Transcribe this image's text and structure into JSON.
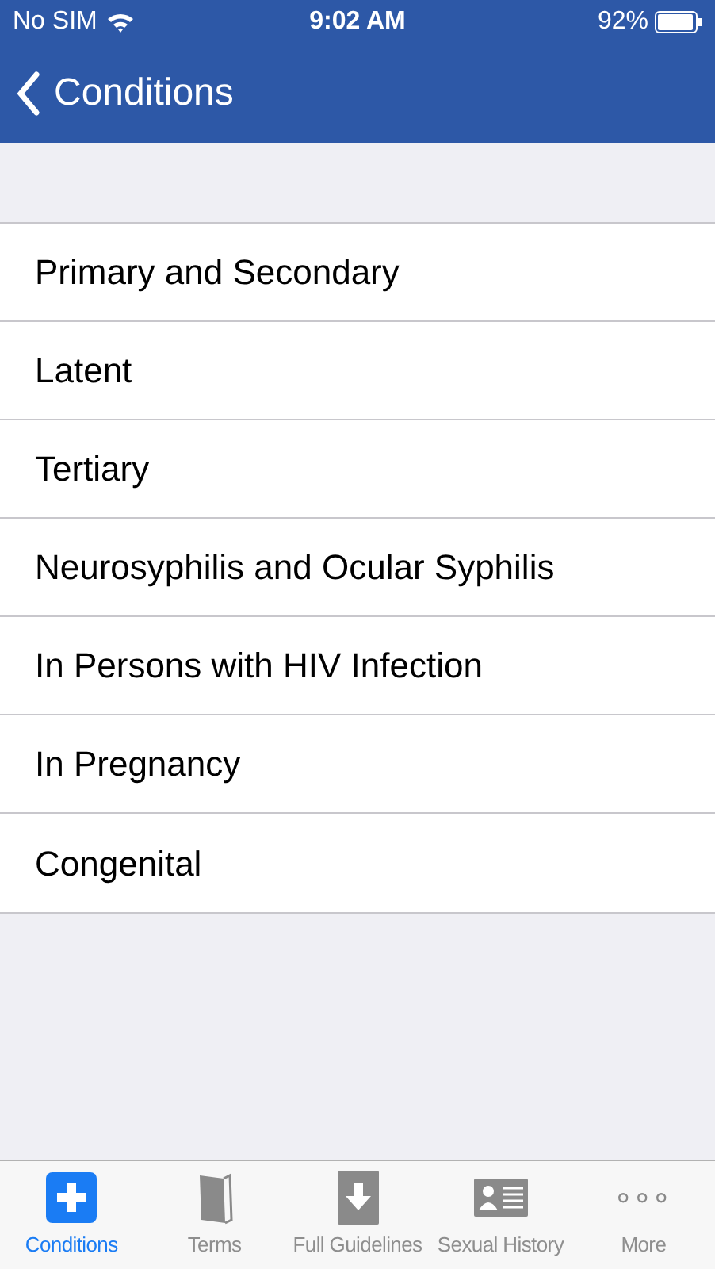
{
  "status_bar": {
    "carrier": "No SIM",
    "time": "9:02 AM",
    "battery": "92%"
  },
  "nav": {
    "back_label": "Conditions"
  },
  "items": [
    {
      "label": "Primary and Secondary"
    },
    {
      "label": "Latent"
    },
    {
      "label": "Tertiary"
    },
    {
      "label": "Neurosyphilis and Ocular Syphilis"
    },
    {
      "label": "In Persons with HIV Infection"
    },
    {
      "label": "In Pregnancy"
    },
    {
      "label": "Congenital"
    }
  ],
  "tabs": [
    {
      "label": "Conditions",
      "kind": "plus",
      "selected": true
    },
    {
      "label": "Terms",
      "kind": "book",
      "selected": false
    },
    {
      "label": "Full Guidelines",
      "kind": "download",
      "selected": false
    },
    {
      "label": "Sexual History",
      "kind": "contact",
      "selected": false
    },
    {
      "label": "More",
      "kind": "more",
      "selected": false
    }
  ]
}
